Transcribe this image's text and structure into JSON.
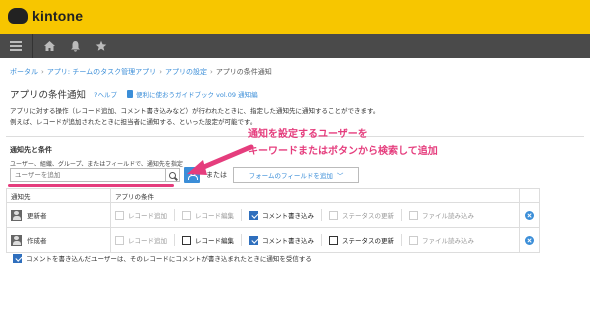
{
  "app": {
    "name": "kintone"
  },
  "breadcrumb": {
    "items": [
      "ポータル",
      "アプリ: チームのタスク管理アプリ",
      "アプリの設定",
      "アプリの条件通知"
    ],
    "separator": "›"
  },
  "page": {
    "title": "アプリの条件通知",
    "help": "?ヘルプ",
    "guide": "便利に使おうガイドブック vol.09 通知編",
    "desc1": "アプリに対する操作（レコード追加、コメント書き込みなど）が行われたときに、指定した通知先に通知することができます。",
    "desc2": "例えば、レコードが追加されたときに担当者に通知する、といった設定が可能です。"
  },
  "section": {
    "title": "通知先と条件",
    "subtitle": "ユーザー、組織、グループ、またはフィールドで、通知先を指定"
  },
  "controls": {
    "search_placeholder": "ユーザーを追加",
    "or_label": "または",
    "field_add": "フォームのフィールドを追加",
    "chevron": "﹀"
  },
  "callout": {
    "line1": "通知を設定するユーザーを",
    "line2": "キーワードまたはボタンから検索して追加"
  },
  "table": {
    "headers": {
      "recipient": "通知先",
      "permission": "アプリの条件"
    },
    "perm_labels": [
      "レコード追加",
      "レコード編集",
      "コメント書き込み",
      "ステータスの更新",
      "ファイル読み込み"
    ],
    "rows": [
      {
        "name": "更新者",
        "checks": [
          false,
          false,
          true,
          false,
          false
        ],
        "enabled": [
          false,
          false,
          true,
          false,
          false
        ]
      },
      {
        "name": "作成者",
        "checks": [
          false,
          false,
          true,
          false,
          false
        ],
        "enabled": [
          false,
          true,
          true,
          true,
          false
        ]
      }
    ]
  },
  "footer": {
    "option_label": "コメントを書き込んだユーザーは、そのレコードにコメントが書き込まれたときに通知を受信する",
    "option_checked": true
  },
  "colors": {
    "brand_yellow": "#f7c600",
    "nav_gray": "#4a4a4a",
    "link_blue": "#3b8ed8",
    "annotation_pink": "#e53d7d"
  }
}
